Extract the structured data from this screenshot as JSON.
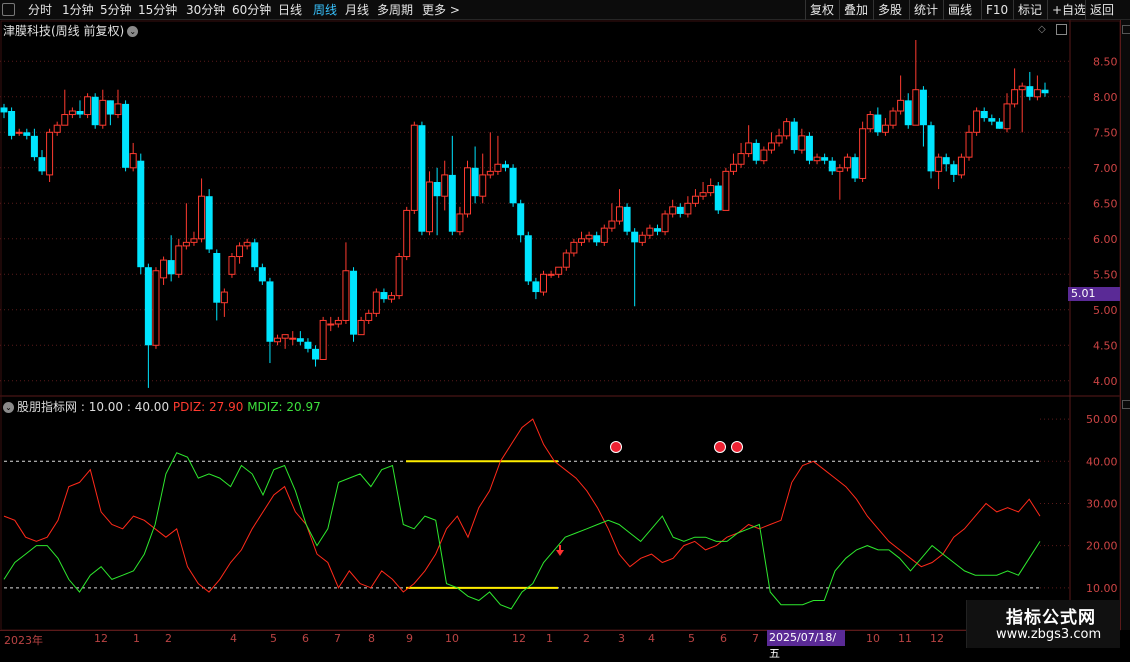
{
  "toolbar": {
    "left": [
      "分时",
      "1分钟",
      "5分钟",
      "15分钟",
      "30分钟",
      "60分钟",
      "日线",
      "周线",
      "月线",
      "多周期",
      "更多 >"
    ],
    "active": "周线",
    "right": [
      "复权",
      "叠加",
      "多股",
      "统计",
      "画线",
      "F10",
      "标记",
      "+自选",
      "返回"
    ]
  },
  "stock": {
    "title": "津膜科技(周线 前复权)"
  },
  "price_axis": [
    "8.50",
    "8.00",
    "7.50",
    "7.00",
    "6.50",
    "6.00",
    "5.50",
    "5.00",
    "4.50",
    "4.00"
  ],
  "last_price": "5.01",
  "indicator": {
    "name": "股朋指标网",
    "params": ": 10.00 : 40.00",
    "pdiz_label": "PDIZ: 27.90",
    "mdiz_label": "MDIZ: 20.97",
    "axis": [
      "50.00",
      "40.00",
      "30.00",
      "20.00",
      "10.00"
    ]
  },
  "dates": [
    {
      "t": "2023年",
      "x": 4
    },
    {
      "t": "12",
      "x": 94
    },
    {
      "t": "1",
      "x": 133
    },
    {
      "t": "2",
      "x": 165
    },
    {
      "t": "4",
      "x": 230
    },
    {
      "t": "5",
      "x": 270
    },
    {
      "t": "6",
      "x": 302
    },
    {
      "t": "7",
      "x": 334
    },
    {
      "t": "8",
      "x": 368
    },
    {
      "t": "9",
      "x": 406
    },
    {
      "t": "10",
      "x": 445
    },
    {
      "t": "12",
      "x": 512
    },
    {
      "t": "1",
      "x": 546
    },
    {
      "t": "2",
      "x": 583
    },
    {
      "t": "3",
      "x": 618
    },
    {
      "t": "4",
      "x": 648
    },
    {
      "t": "5",
      "x": 688
    },
    {
      "t": "6",
      "x": 720
    },
    {
      "t": "7",
      "x": 752
    },
    {
      "t": "10",
      "x": 866
    },
    {
      "t": "11",
      "x": 898
    },
    {
      "t": "12",
      "x": 930
    }
  ],
  "highlighted_date": "2025/07/18/五",
  "watermark": {
    "line1": "指标公式网",
    "line2": "www.zbgs3.com"
  },
  "colors": {
    "up": "#ff3b30",
    "down": "#00e5ff",
    "pdiz": "#ff2a1a",
    "mdiz": "#2ee82e",
    "level": "#ffee00",
    "grid": "#5a1a1a"
  },
  "chart_data": {
    "type": "candlestick",
    "ylim": [
      3.8,
      8.8
    ],
    "candles": [
      [
        7.85,
        7.78,
        7.9,
        7.7
      ],
      [
        7.8,
        7.45,
        7.85,
        7.4
      ],
      [
        7.5,
        7.5,
        7.55,
        7.45
      ],
      [
        7.5,
        7.45,
        7.55,
        7.4
      ],
      [
        7.45,
        7.15,
        7.55,
        7.1
      ],
      [
        7.15,
        6.95,
        7.25,
        6.9
      ],
      [
        6.9,
        7.5,
        7.55,
        6.8
      ],
      [
        7.5,
        7.6,
        7.65,
        7.45
      ],
      [
        7.6,
        7.75,
        8.1,
        7.6
      ],
      [
        7.75,
        7.8,
        7.85,
        7.7
      ],
      [
        7.8,
        7.75,
        7.95,
        7.7
      ],
      [
        7.75,
        8.0,
        8.05,
        7.7
      ],
      [
        8.0,
        7.6,
        8.05,
        7.55
      ],
      [
        7.6,
        7.95,
        8.1,
        7.55
      ],
      [
        7.95,
        7.75,
        7.95,
        7.6
      ],
      [
        7.75,
        7.9,
        8.1,
        7.7
      ],
      [
        7.9,
        7.0,
        7.95,
        6.95
      ],
      [
        7.0,
        7.2,
        7.35,
        6.95
      ],
      [
        7.1,
        5.6,
        7.2,
        5.5
      ],
      [
        5.6,
        4.5,
        5.65,
        3.9
      ],
      [
        4.5,
        5.55,
        5.6,
        4.45
      ],
      [
        5.45,
        5.7,
        5.75,
        5.35
      ],
      [
        5.7,
        5.5,
        6.05,
        5.4
      ],
      [
        5.5,
        5.9,
        6.0,
        5.45
      ],
      [
        5.9,
        5.95,
        6.5,
        5.85
      ],
      [
        5.95,
        6.0,
        6.1,
        5.9
      ],
      [
        6.0,
        6.6,
        6.85,
        5.95
      ],
      [
        6.6,
        5.85,
        6.7,
        5.8
      ],
      [
        5.8,
        5.1,
        5.85,
        4.85
      ],
      [
        5.1,
        5.25,
        5.3,
        4.9
      ],
      [
        5.5,
        5.75,
        5.8,
        5.45
      ],
      [
        5.75,
        5.9,
        5.95,
        5.65
      ],
      [
        5.9,
        5.95,
        6.0,
        5.85
      ],
      [
        5.95,
        5.6,
        6.0,
        5.55
      ],
      [
        5.6,
        5.4,
        5.65,
        5.35
      ],
      [
        5.4,
        4.55,
        5.45,
        4.25
      ],
      [
        4.55,
        4.6,
        4.65,
        4.5
      ],
      [
        4.6,
        4.65,
        4.65,
        4.45
      ],
      [
        4.6,
        4.6,
        4.7,
        4.5
      ],
      [
        4.6,
        4.55,
        4.7,
        4.5
      ],
      [
        4.55,
        4.45,
        4.6,
        4.4
      ],
      [
        4.45,
        4.3,
        4.5,
        4.2
      ],
      [
        4.3,
        4.85,
        4.9,
        4.3
      ],
      [
        4.8,
        4.8,
        4.9,
        4.7
      ],
      [
        4.8,
        4.85,
        4.9,
        4.75
      ],
      [
        4.85,
        5.55,
        5.95,
        4.8
      ],
      [
        5.55,
        4.65,
        5.6,
        4.55
      ],
      [
        4.65,
        4.85,
        4.9,
        4.65
      ],
      [
        4.85,
        4.95,
        5.0,
        4.8
      ],
      [
        4.95,
        5.25,
        5.3,
        4.9
      ],
      [
        5.25,
        5.15,
        5.3,
        5.1
      ],
      [
        5.15,
        5.2,
        5.25,
        5.1
      ],
      [
        5.2,
        5.75,
        5.8,
        5.15
      ],
      [
        5.75,
        6.4,
        6.45,
        5.7
      ],
      [
        6.4,
        7.6,
        7.65,
        6.35
      ],
      [
        7.6,
        6.1,
        7.65,
        6.05
      ],
      [
        6.1,
        6.8,
        6.95,
        6.05
      ],
      [
        6.8,
        6.6,
        7.0,
        6.05
      ],
      [
        6.6,
        6.9,
        7.1,
        6.4
      ],
      [
        6.9,
        6.1,
        7.45,
        6.05
      ],
      [
        6.1,
        6.35,
        6.45,
        6.05
      ],
      [
        6.35,
        7.0,
        7.1,
        6.3
      ],
      [
        7.0,
        6.6,
        7.3,
        6.5
      ],
      [
        6.6,
        6.9,
        7.2,
        6.5
      ],
      [
        6.9,
        6.95,
        7.5,
        6.85
      ],
      [
        6.95,
        7.05,
        7.45,
        6.9
      ],
      [
        7.05,
        7.0,
        7.1,
        6.95
      ],
      [
        7.0,
        6.5,
        7.05,
        6.45
      ],
      [
        6.5,
        6.05,
        6.55,
        5.95
      ],
      [
        6.05,
        5.4,
        6.1,
        5.35
      ],
      [
        5.4,
        5.25,
        5.45,
        5.15
      ],
      [
        5.25,
        5.5,
        5.55,
        5.2
      ],
      [
        5.5,
        5.5,
        5.55,
        5.45
      ],
      [
        5.5,
        5.6,
        5.6,
        5.45
      ],
      [
        5.6,
        5.8,
        5.85,
        5.55
      ],
      [
        5.8,
        5.95,
        6.0,
        5.75
      ],
      [
        5.95,
        6.0,
        6.1,
        5.9
      ],
      [
        6.0,
        6.05,
        6.1,
        5.95
      ],
      [
        6.05,
        5.95,
        6.1,
        5.9
      ],
      [
        5.95,
        6.15,
        6.2,
        5.9
      ],
      [
        6.15,
        6.25,
        6.5,
        6.1
      ],
      [
        6.25,
        6.45,
        6.7,
        6.2
      ],
      [
        6.45,
        6.1,
        6.5,
        6.05
      ],
      [
        6.1,
        5.95,
        6.15,
        5.05
      ],
      [
        5.95,
        6.05,
        6.1,
        5.9
      ],
      [
        6.05,
        6.15,
        6.2,
        6.0
      ],
      [
        6.15,
        6.1,
        6.2,
        6.05
      ],
      [
        6.1,
        6.35,
        6.4,
        6.05
      ],
      [
        6.35,
        6.45,
        6.55,
        6.3
      ],
      [
        6.45,
        6.35,
        6.5,
        6.3
      ],
      [
        6.35,
        6.5,
        6.6,
        6.3
      ],
      [
        6.5,
        6.6,
        6.7,
        6.45
      ],
      [
        6.6,
        6.65,
        6.8,
        6.55
      ],
      [
        6.65,
        6.75,
        6.85,
        6.6
      ],
      [
        6.75,
        6.4,
        6.8,
        6.35
      ],
      [
        6.4,
        6.95,
        7.0,
        6.4
      ],
      [
        6.95,
        7.05,
        7.2,
        6.9
      ],
      [
        7.05,
        7.2,
        7.35,
        7.0
      ],
      [
        7.2,
        7.35,
        7.6,
        7.15
      ],
      [
        7.35,
        7.1,
        7.4,
        7.05
      ],
      [
        7.1,
        7.25,
        7.3,
        7.05
      ],
      [
        7.25,
        7.35,
        7.5,
        7.2
      ],
      [
        7.35,
        7.45,
        7.55,
        7.3
      ],
      [
        7.45,
        7.65,
        7.7,
        7.4
      ],
      [
        7.65,
        7.25,
        7.7,
        7.2
      ],
      [
        7.25,
        7.45,
        7.55,
        7.2
      ],
      [
        7.45,
        7.1,
        7.5,
        7.05
      ],
      [
        7.1,
        7.15,
        7.2,
        7.05
      ],
      [
        7.15,
        7.1,
        7.2,
        7.05
      ],
      [
        7.1,
        6.95,
        7.15,
        6.9
      ],
      [
        6.95,
        7.0,
        7.05,
        6.55
      ],
      [
        7.0,
        7.15,
        7.2,
        6.95
      ],
      [
        7.15,
        6.85,
        7.2,
        6.8
      ],
      [
        6.85,
        7.55,
        7.65,
        6.8
      ],
      [
        7.55,
        7.75,
        7.8,
        7.5
      ],
      [
        7.75,
        7.5,
        7.85,
        7.45
      ],
      [
        7.5,
        7.6,
        7.7,
        7.45
      ],
      [
        7.6,
        7.8,
        7.85,
        7.55
      ],
      [
        7.8,
        7.95,
        8.3,
        7.75
      ],
      [
        7.95,
        7.6,
        8.05,
        7.55
      ],
      [
        7.6,
        8.1,
        8.8,
        7.6
      ],
      [
        8.1,
        7.6,
        8.15,
        7.3
      ],
      [
        7.6,
        6.95,
        7.65,
        6.85
      ],
      [
        6.95,
        7.15,
        7.2,
        6.7
      ],
      [
        7.15,
        7.05,
        7.2,
        6.95
      ],
      [
        7.05,
        6.9,
        7.1,
        6.8
      ],
      [
        6.9,
        7.15,
        7.2,
        6.85
      ],
      [
        7.15,
        7.5,
        7.6,
        7.1
      ],
      [
        7.5,
        7.8,
        7.85,
        7.45
      ],
      [
        7.8,
        7.7,
        7.85,
        7.65
      ],
      [
        7.7,
        7.65,
        7.75,
        7.6
      ],
      [
        7.65,
        7.55,
        7.7,
        7.55
      ],
      [
        7.55,
        7.9,
        8.05,
        7.5
      ],
      [
        7.9,
        8.1,
        8.4,
        7.85
      ],
      [
        8.1,
        8.15,
        8.2,
        7.5
      ],
      [
        8.15,
        8.0,
        8.35,
        7.95
      ],
      [
        8.0,
        8.1,
        8.3,
        7.95
      ],
      [
        8.1,
        8.05,
        8.2,
        8.0
      ]
    ],
    "indicator": {
      "ylim": [
        0,
        55
      ],
      "levels": [
        40,
        10
      ],
      "pdiz": [
        27,
        26,
        22,
        21,
        22,
        26,
        34,
        35,
        38,
        28,
        25,
        24,
        27,
        26,
        24,
        22,
        24,
        15,
        11,
        9,
        12,
        16,
        19,
        24,
        28,
        32,
        34,
        28,
        25,
        18,
        16,
        10,
        14,
        11,
        10,
        14,
        12,
        9,
        11,
        14,
        18,
        24,
        27,
        22,
        29,
        33,
        40,
        44,
        48,
        50,
        44,
        40,
        38,
        36,
        33,
        29,
        24,
        18,
        15,
        17,
        18,
        16,
        17,
        20,
        21,
        19,
        20,
        22,
        23,
        25,
        24,
        25,
        26,
        35,
        39,
        40,
        38,
        36,
        34,
        31,
        27,
        24,
        21,
        19,
        17,
        15,
        16,
        18,
        22,
        24,
        27,
        30,
        28,
        29,
        28,
        31,
        27
      ],
      "mdiz": [
        12,
        16,
        18,
        20,
        20,
        17,
        12,
        9,
        13,
        15,
        12,
        13,
        14,
        18,
        25,
        37,
        42,
        41,
        36,
        37,
        36,
        34,
        39,
        37,
        32,
        38,
        39,
        33,
        25,
        20,
        24,
        35,
        36,
        37,
        34,
        38,
        39,
        25,
        24,
        27,
        26,
        11,
        10,
        8,
        7,
        9,
        6,
        5,
        9,
        11,
        16,
        19,
        22,
        23,
        24,
        25,
        26,
        25,
        23,
        21,
        24,
        27,
        22,
        21,
        22,
        22,
        21,
        21,
        23,
        24,
        25,
        9,
        6,
        6,
        6,
        7,
        7,
        14,
        17,
        19,
        20,
        19,
        19,
        17,
        14,
        17,
        20,
        18,
        16,
        14,
        13,
        13,
        13,
        14,
        13,
        17,
        21
      ],
      "yellow_segments": [
        [
          406,
          558,
          40
        ],
        [
          406,
          558,
          10
        ]
      ]
    }
  }
}
